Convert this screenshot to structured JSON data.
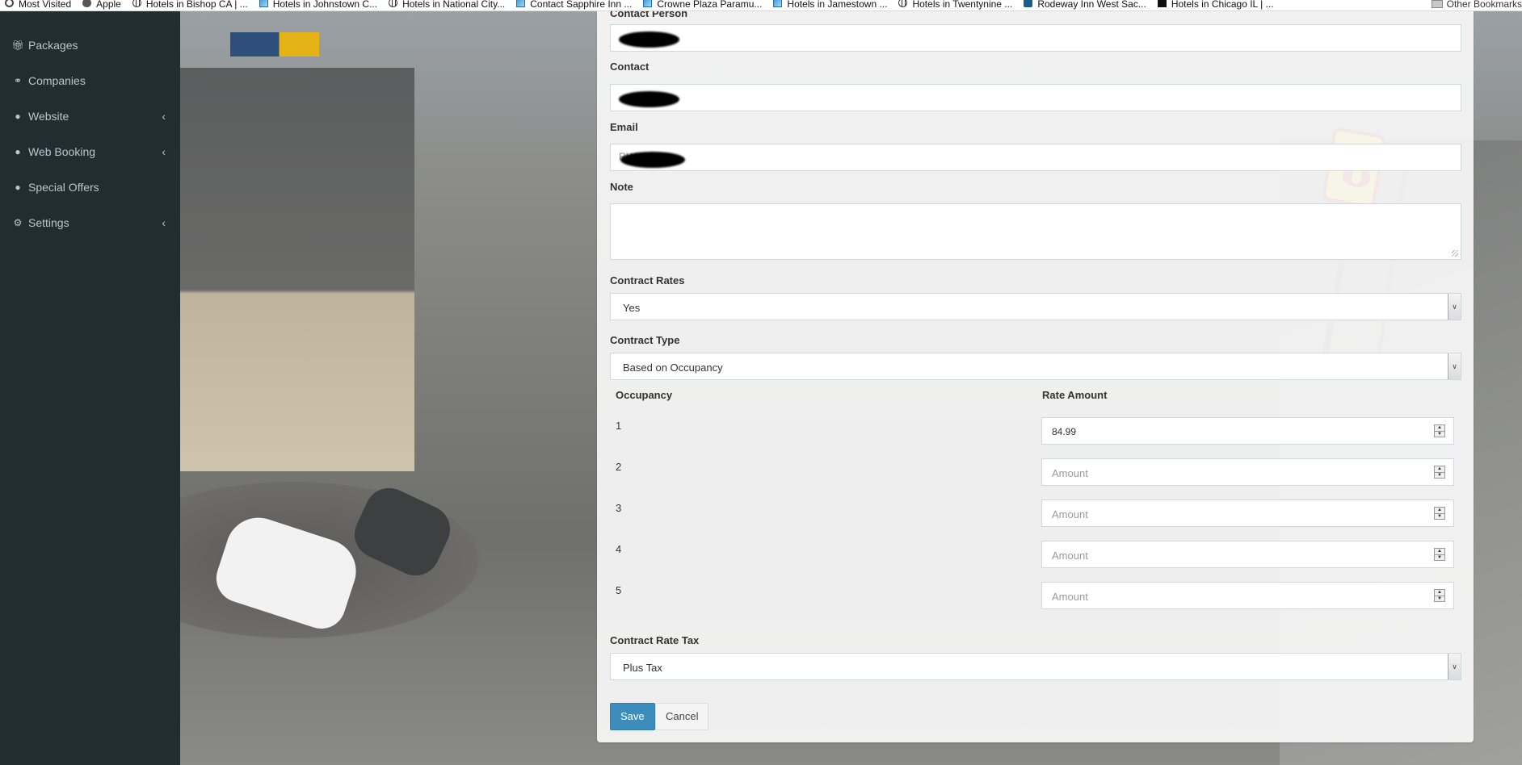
{
  "bookmarks": {
    "items": [
      {
        "label": "Most Visited",
        "icon": "gear-icon"
      },
      {
        "label": "Apple",
        "icon": "apple-icon"
      },
      {
        "label": "Hotels in Bishop CA | ...",
        "icon": "globe-icon"
      },
      {
        "label": "Hotels in Johnstown C...",
        "icon": "image-icon"
      },
      {
        "label": "Hotels in National City...",
        "icon": "globe-icon"
      },
      {
        "label": "Contact Sapphire Inn ...",
        "icon": "image-icon"
      },
      {
        "label": "Crowne Plaza Paramu...",
        "icon": "image-icon"
      },
      {
        "label": "Hotels in Jamestown ...",
        "icon": "image-icon"
      },
      {
        "label": "Hotels in Twentynine ...",
        "icon": "globe-icon"
      },
      {
        "label": "Rodeway Inn West Sac...",
        "icon": "seal-icon"
      },
      {
        "label": "Hotels in Chicago IL | ...",
        "icon": "dark-icon"
      }
    ],
    "more": "»",
    "other": "Other Bookmarks"
  },
  "sidebar": {
    "items": [
      {
        "label": "Packages",
        "icon": "gift-icon",
        "has_children": false
      },
      {
        "label": "Companies",
        "icon": "handshake-icon",
        "has_children": false
      },
      {
        "label": "Website",
        "icon": "globe-icon",
        "has_children": true
      },
      {
        "label": "Web Booking",
        "icon": "globe-icon",
        "has_children": true
      },
      {
        "label": "Special Offers",
        "icon": "globe-icon",
        "has_children": false
      },
      {
        "label": "Settings",
        "icon": "gears-icon",
        "has_children": true
      }
    ],
    "chevron": "‹"
  },
  "form": {
    "contact_person_label": "Contact Person",
    "contact_label": "Contact",
    "email_label": "Email",
    "email_value_partial": "RHAN@...",
    "note_label": "Note",
    "contract_rates_label": "Contract Rates",
    "contract_rates_value": "Yes",
    "contract_type_label": "Contract Type",
    "contract_type_value": "Based on Occupancy",
    "occupancy_header": "Occupancy",
    "rate_amount_header": "Rate Amount",
    "rates": [
      {
        "occupancy": "1",
        "value": "84.99",
        "placeholder": "Amount"
      },
      {
        "occupancy": "2",
        "value": "",
        "placeholder": "Amount"
      },
      {
        "occupancy": "3",
        "value": "",
        "placeholder": "Amount"
      },
      {
        "occupancy": "4",
        "value": "",
        "placeholder": "Amount"
      },
      {
        "occupancy": "5",
        "value": "",
        "placeholder": "Amount"
      }
    ],
    "contract_rate_tax_label": "Contract Rate Tax",
    "contract_rate_tax_value": "Plus Tax",
    "save_label": "Save",
    "cancel_label": "Cancel"
  },
  "colors": {
    "sidebar_bg": "#222d32",
    "sidebar_text": "#b8c7ce",
    "primary_button": "#3c8dbc"
  }
}
